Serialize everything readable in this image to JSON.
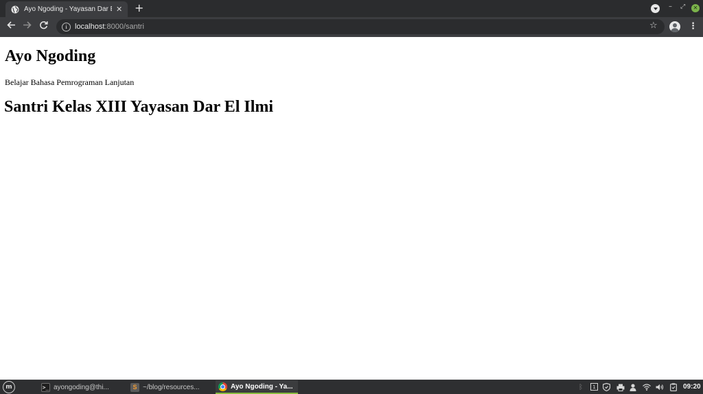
{
  "browser": {
    "tab": {
      "title": "Ayo Ngoding - Yayasan Dar El Ilmi",
      "close_glyph": "✕"
    },
    "new_tab_glyph": "+",
    "address": {
      "host": "localhost",
      "path": ":8000/santri"
    },
    "icons": {
      "back": "arrow-left-icon",
      "forward": "arrow-right-icon",
      "reload": "reload-icon",
      "info": "info-icon",
      "bookmark": "star-icon",
      "profile": "account-icon",
      "menu": "kebab-menu-icon"
    }
  },
  "page": {
    "title": "Ayo Ngoding",
    "subtitle": "Belajar Bahasa Pemrograman Lanjutan",
    "heading": "Santri Kelas XIII Yayasan Dar El Ilmi"
  },
  "taskbar": {
    "menu_icon": "linux-mint-menu-icon",
    "tasks": [
      {
        "label": "ayongoding@thi...",
        "icon": "terminal-icon"
      },
      {
        "label": "~/blog/resources...",
        "icon": "sublime-text-icon"
      },
      {
        "label": "Ayo Ngoding - Ya...",
        "icon": "chrome-icon",
        "active": true
      }
    ],
    "clock": "09:20",
    "accent_color": "#87bb3f"
  }
}
